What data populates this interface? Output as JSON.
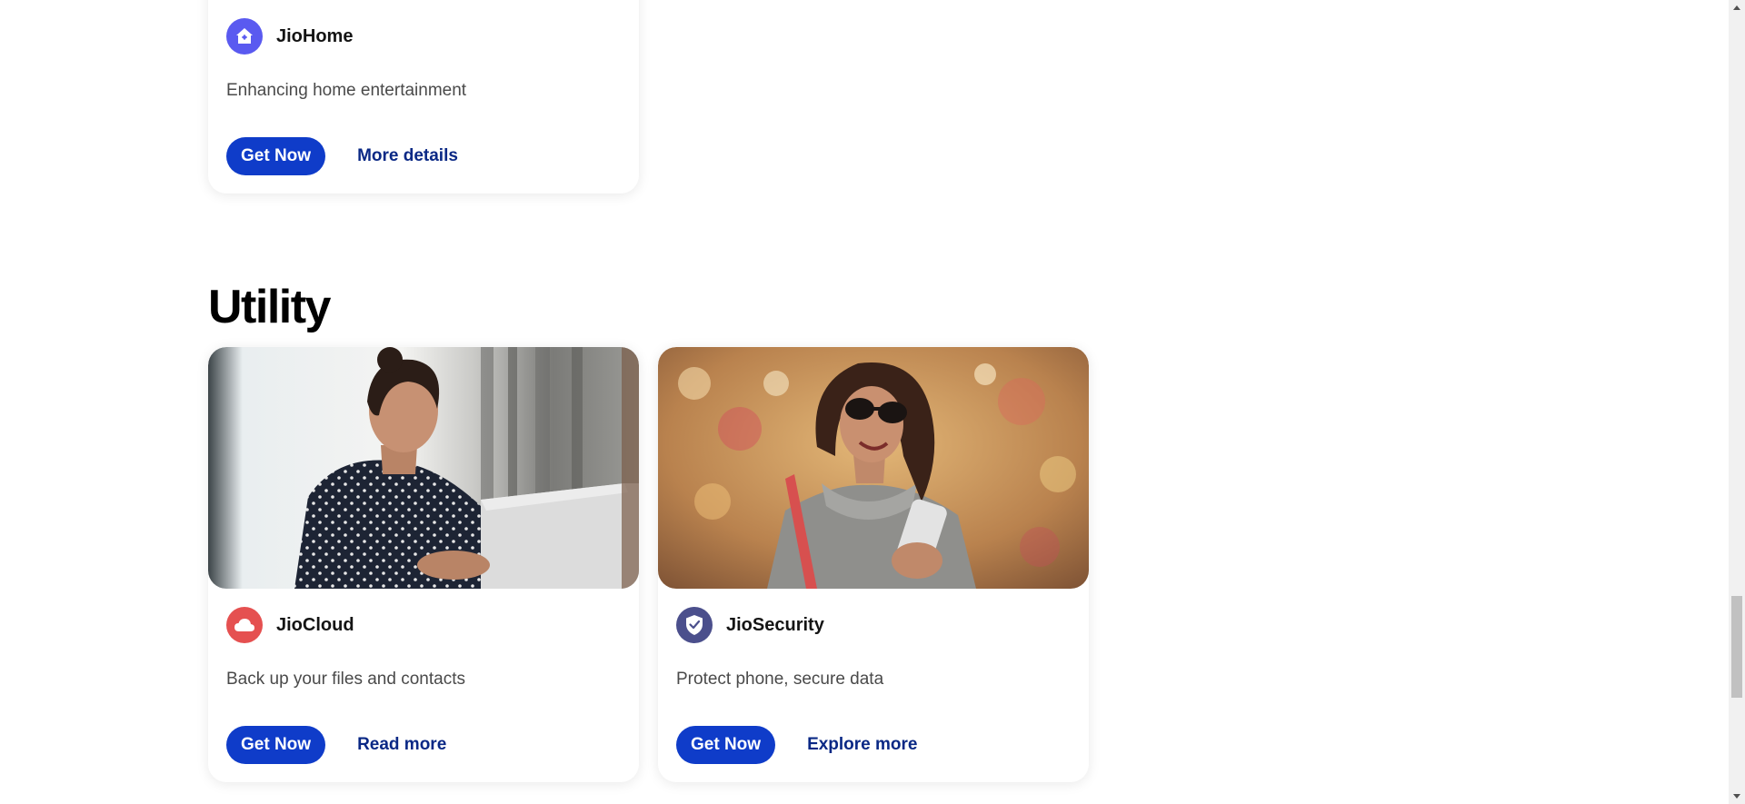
{
  "cards_top": [
    {
      "name": "JioHome",
      "description": "Enhancing home entertainment",
      "primary_label": "Get Now",
      "secondary_label": "More details",
      "icon": "home-icon",
      "icon_color": "#5a5af0"
    }
  ],
  "section": {
    "title": "Utility"
  },
  "cards_utility": [
    {
      "name": "JioCloud",
      "description": "Back up your files and contacts",
      "primary_label": "Get Now",
      "secondary_label": "Read more",
      "icon": "cloud-icon",
      "icon_color": "#e55050",
      "image": "woman-laptop-image"
    },
    {
      "name": "JioSecurity",
      "description": "Protect phone, secure data",
      "primary_label": "Get Now",
      "secondary_label": "Explore more",
      "icon": "shield-check-icon",
      "icon_color": "#4b4f8c",
      "image": "woman-phone-image"
    }
  ],
  "colors": {
    "primary_button": "#0f3cc9",
    "link": "#0a2885",
    "text": "#141414"
  }
}
